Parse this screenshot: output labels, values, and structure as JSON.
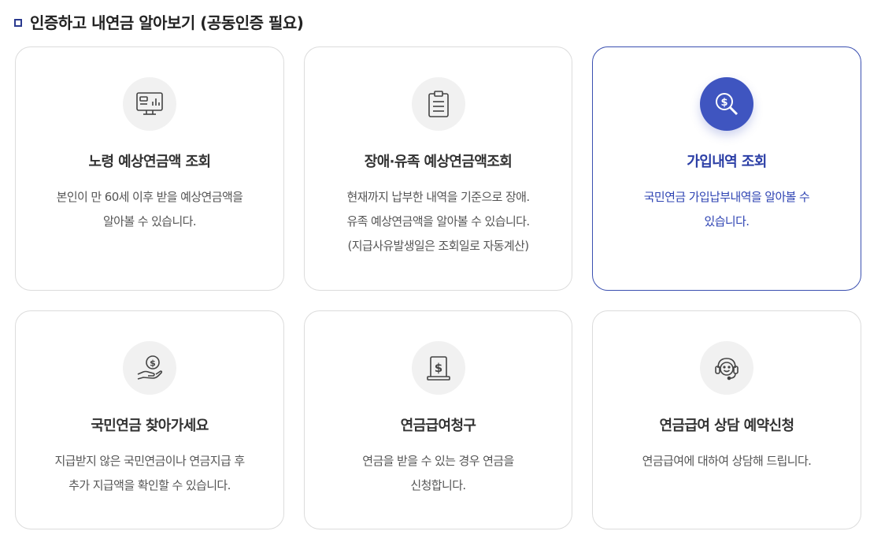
{
  "section": {
    "title": "인증하고 내연금 알아보기 (공동인증 필요)"
  },
  "cards": [
    {
      "title": "노령 예상연금액 조회",
      "icon": "monitor-chart-icon",
      "desc": [
        "본인이 만 60세 이후 받을 예상연금액을",
        "알아볼 수 있습니다."
      ]
    },
    {
      "title": "장애·유족 예상연금액조회",
      "icon": "clipboard-icon",
      "desc": [
        "현재까지 납부한 내역을 기준으로 장애.",
        "유족 예상연금액을 알아볼 수 있습니다.",
        "(지급사유발생일은 조회일로 자동계산)"
      ]
    },
    {
      "title": "가입내역 조회",
      "icon": "search-dollar-icon",
      "desc": [
        "국민연금 가입납부내역을 알아볼 수",
        "있습니다."
      ]
    },
    {
      "title": "국민연금 찾아가세요",
      "icon": "hand-coin-icon",
      "desc": [
        "지급받지 않은 국민연금이나 연금지급 후",
        "추가 지급액을 확인할 수 있습니다."
      ]
    },
    {
      "title": "연금급여청구",
      "icon": "dollar-document-icon",
      "desc": [
        "연금을 받을 수 있는 경우 연금을",
        "신청합니다."
      ]
    },
    {
      "title": "연금급여 상담 예약신청",
      "icon": "headset-icon",
      "desc": [
        "연금급여에 대하여 상담해 드립니다."
      ]
    }
  ],
  "colors": {
    "accent": "#3f55c0",
    "active_border": "#3a4fb0",
    "card_border": "#dcdcdc",
    "icon_bg": "#f1f1f1"
  }
}
